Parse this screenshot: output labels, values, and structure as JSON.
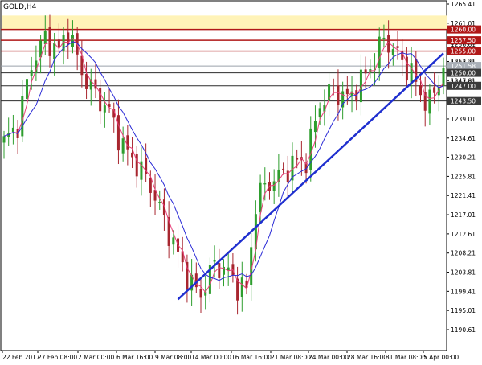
{
  "chart_title": "GOLD,H4",
  "colors": {
    "background": "#ffffff",
    "bull_candle": "#2e9e2e",
    "bear_candle": "#a8262f",
    "ma_fast": "#e8407a",
    "ma_slow": "#2b2bd6",
    "trendline": "#1f2fcf",
    "zone_fill": "#fff3b8",
    "resistance_line": "#b01818",
    "support_line": "#2b2b2b",
    "current_price_line": "#9aa0aa",
    "tag_red": "#b01818",
    "tag_dark": "#3a3a3a",
    "tag_gray": "#aab0b8"
  },
  "chart_data": {
    "type": "candlestick",
    "title": "GOLD,H4",
    "ylim": [
      1186,
      1266.6
    ],
    "y_ticks": [
      "1265.41",
      "1261.01",
      "1256.61",
      "1252.21",
      "1247.81",
      "1243.41",
      "1239.01",
      "1234.61",
      "1230.21",
      "1225.81",
      "1221.41",
      "1217.01",
      "1212.61",
      "1208.21",
      "1203.81",
      "1199.41",
      "1195.01",
      "1190.61"
    ],
    "x_ticks": [
      "22 Feb 2017",
      "27 Feb 08:00",
      "2 Mar 00:00",
      "6 Mar 16:00",
      "9 Mar 08:00",
      "14 Mar 00:00",
      "16 Mar 16:00",
      "21 Mar 08:00",
      "24 Mar 00:00",
      "28 Mar 16:00",
      "31 Mar 08:00",
      "5 Apr 00:00"
    ],
    "price_levels": [
      {
        "label": "1260.00",
        "value": 1260.0,
        "kind": "resistance"
      },
      {
        "label": "1257.50",
        "value": 1257.5,
        "kind": "resistance"
      },
      {
        "label": "1255.00",
        "value": 1255.0,
        "kind": "resistance"
      },
      {
        "label": "1251.58",
        "value": 1251.58,
        "kind": "current"
      },
      {
        "label": "1250.00",
        "value": 1250.0,
        "kind": "support"
      },
      {
        "label": "1247.00",
        "value": 1247.0,
        "kind": "support"
      },
      {
        "label": "1243.50",
        "value": 1243.5,
        "kind": "support"
      }
    ],
    "extra_axis_labels": [
      "1256.61",
      "1252.21",
      "1247.81"
    ],
    "resistance_zone": [
      1260.0,
      1263.2
    ],
    "trendline": {
      "from": [
        38,
        1197.8
      ],
      "to": [
        96,
        1254.5
      ]
    },
    "candles_count": 97
  }
}
